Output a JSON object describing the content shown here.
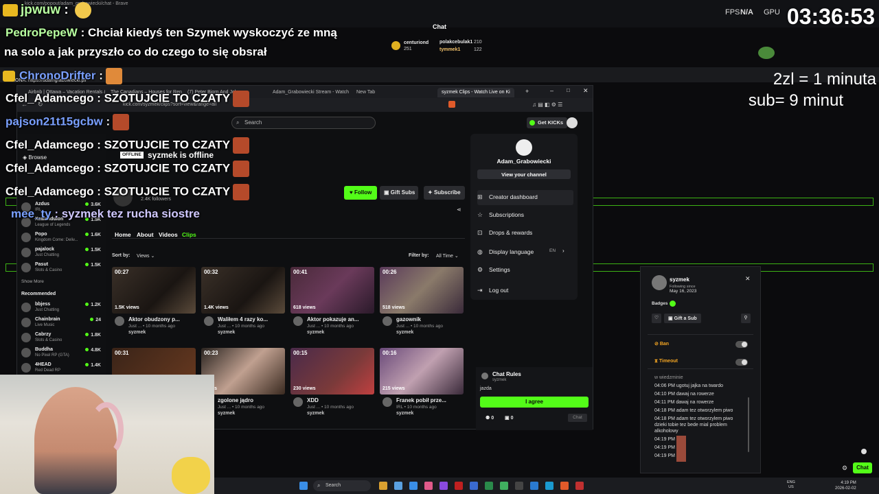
{
  "hud": {
    "browser_title": "kick.com/popout/adam_grabowiecki/chat - Brave",
    "fps_label": "FPS",
    "fps_value": "N/A",
    "gpu_label": "GPU",
    "clock": "03:36:53",
    "chat_label": "Chat",
    "top_user": "jpwuw",
    "top_sep": ":"
  },
  "overlay_messages": [
    {
      "user": "PedroPepeW",
      "text": "Chciał kiedyś ten Szymek wyskoczyć ze mną"
    },
    {
      "user": "",
      "text": "na solo a jak przyszło co do czego to się obsrał"
    },
    {
      "user": "ChronoDrifter",
      "text": ":"
    },
    {
      "user": "Cfel_Adamcego",
      "text": "SZOTUJCIE TO CZATY"
    },
    {
      "user": "pajson21t15gcbw",
      "text": ":"
    },
    {
      "user": "Cfel_Adamcego",
      "text": "SZOTUJCIE TO CZATY"
    },
    {
      "user": "Cfel_Adamcego",
      "text": "SZOTUJCIE TO CZATY"
    },
    {
      "user": "Cfel_Adamcego",
      "text": "SZOTUJCIE TO CZATY"
    },
    {
      "user": "mee_ty",
      "text": "syzmek tez rucha siostre"
    }
  ],
  "strona": "STRONA: https://adamgrabowiecki.pl/",
  "price_info": {
    "line1": "2zl = 1 minuta",
    "line2": "sub= 9 minut"
  },
  "leaderboard": [
    {
      "name": "centuriond",
      "value": "251"
    },
    {
      "name": "polakcebulak1",
      "value": "210"
    },
    {
      "name": "tymmek1",
      "value": "122"
    }
  ],
  "browser": {
    "tabs": [
      "Airbnb | Ottawa – Vacation Rentals &",
      "The Canadians – Houses for Rent in",
      "(7) Peter Bjorn And John",
      "Adam_Grabowiecki Stream - Watch",
      "New Tab",
      "syzmek Clips - Watch Live on Ki"
    ],
    "url": "kick.com/syzmek/clips?sort=view&range=all",
    "search_placeholder": "Search",
    "get_kicks": "Get KICKs",
    "offline_badge": "OFFLINE",
    "offline_text": "syzmek is offline",
    "followers": "2.4K followers",
    "follow": "Follow",
    "gift_subs": "Gift Subs",
    "subscribe": "Subscribe",
    "nav": [
      "Home",
      "About",
      "Videos",
      "Clips"
    ],
    "sort_label": "Sort by:",
    "sort_value": "Views",
    "filter_label": "Filter by:",
    "filter_value": "All Time"
  },
  "sidebar": {
    "browse": "Browse",
    "following": [
      {
        "name": "Azdus",
        "cat": "IRL",
        "viewers": "3.6K"
      },
      {
        "name": "Xzalanduion",
        "cat": "League of Legends",
        "viewers": "1.5K"
      },
      {
        "name": "Popo",
        "cat": "Kingdom Come: Deliv...",
        "viewers": "1.6K"
      },
      {
        "name": "pajalock",
        "cat": "Just Chatting",
        "viewers": "1.5K"
      },
      {
        "name": "Pasut",
        "cat": "Slots & Casino",
        "viewers": "1.5K"
      }
    ],
    "show_more": "Show More",
    "recommended_label": "Recommended",
    "recommended": [
      {
        "name": "bbjess",
        "cat": "Just Chatting",
        "viewers": "1.2K"
      },
      {
        "name": "Chainbrain",
        "cat": "Live Music",
        "viewers": "24"
      },
      {
        "name": "Cabrzy",
        "cat": "Slots & Casino",
        "viewers": "1.8K"
      },
      {
        "name": "Buddha",
        "cat": "No Pixel RP (GTA)",
        "viewers": "4.8K"
      },
      {
        "name": "4HEAD",
        "cat": "Red Dead RP",
        "viewers": "1.4K"
      }
    ]
  },
  "clips": [
    {
      "duration": "00:27",
      "views": "1.5K views",
      "title": "Aktor obudzony p...",
      "meta": "Just ... • 10 months ago",
      "author": "syzmek"
    },
    {
      "duration": "00:32",
      "views": "1.4K views",
      "title": "Waliłem 4 razy ko...",
      "meta": "Just ... • 10 months ago",
      "author": "syzmek"
    },
    {
      "duration": "00:41",
      "views": "618 views",
      "title": "Aktor pokazuje an...",
      "meta": "Just ... • 10 months ago",
      "author": "syzmek"
    },
    {
      "duration": "00:26",
      "views": "518 views",
      "title": "gazownik",
      "meta": "Just ... • 10 months ago",
      "author": "syzmek"
    },
    {
      "duration": "00:31",
      "views": "",
      "title": "",
      "meta": "",
      "author": ""
    },
    {
      "duration": "00:23",
      "views": "views",
      "title": "zgolone jądro",
      "meta": "Just ... • 10 months ago",
      "author": "syzmek"
    },
    {
      "duration": "00:15",
      "views": "230 views",
      "title": "XDD",
      "meta": "Just ... • 10 months ago",
      "author": "syzmek"
    },
    {
      "duration": "00:16",
      "views": "215 views",
      "title": "Franek pobił prze...",
      "meta": "IRL • 10 months ago",
      "author": "syzmek"
    }
  ],
  "user_menu": {
    "username": "Adam_Grabowiecki",
    "view_channel": "View your channel",
    "items": [
      "Creator dashboard",
      "Subscriptions",
      "Drops & rewards",
      "Display language",
      "Settings",
      "Log out"
    ],
    "lang_value": "EN"
  },
  "chat_rules": {
    "title": "Chat Rules",
    "owner": "syzmek",
    "rule": "jazda",
    "agree": "I agree",
    "count1": "0",
    "count2": "0",
    "chat_btn": "Chat"
  },
  "modcard": {
    "username": "syzmek",
    "following_since_label": "Following since",
    "following_since": "May 16, 2023",
    "badges_label": "Badges",
    "gift_sub": "Gift a Sub",
    "ban": "Ban",
    "timeout": "Timeout",
    "log": [
      "w wiedzminie",
      "04:06 PM ugotuj jajka na twardo",
      "04:10 PM dawaj na rowerze",
      "04:11 PM dawaj na rowerze",
      "04:18 PM adam tez otworzylem piwo",
      "04:18 PM adam tez otworzylem piwo",
      "dzieki tobie tez bede mial problem",
      "alkoholowy",
      "04:19 PM",
      "04:19 PM",
      "04:19 PM"
    ]
  },
  "bottom_chat_btn": "Chat",
  "taskbar": {
    "search": "Search",
    "lang1": "ENG",
    "lang2": "US",
    "time": "4:19 PM",
    "date": "2026-02-02"
  }
}
